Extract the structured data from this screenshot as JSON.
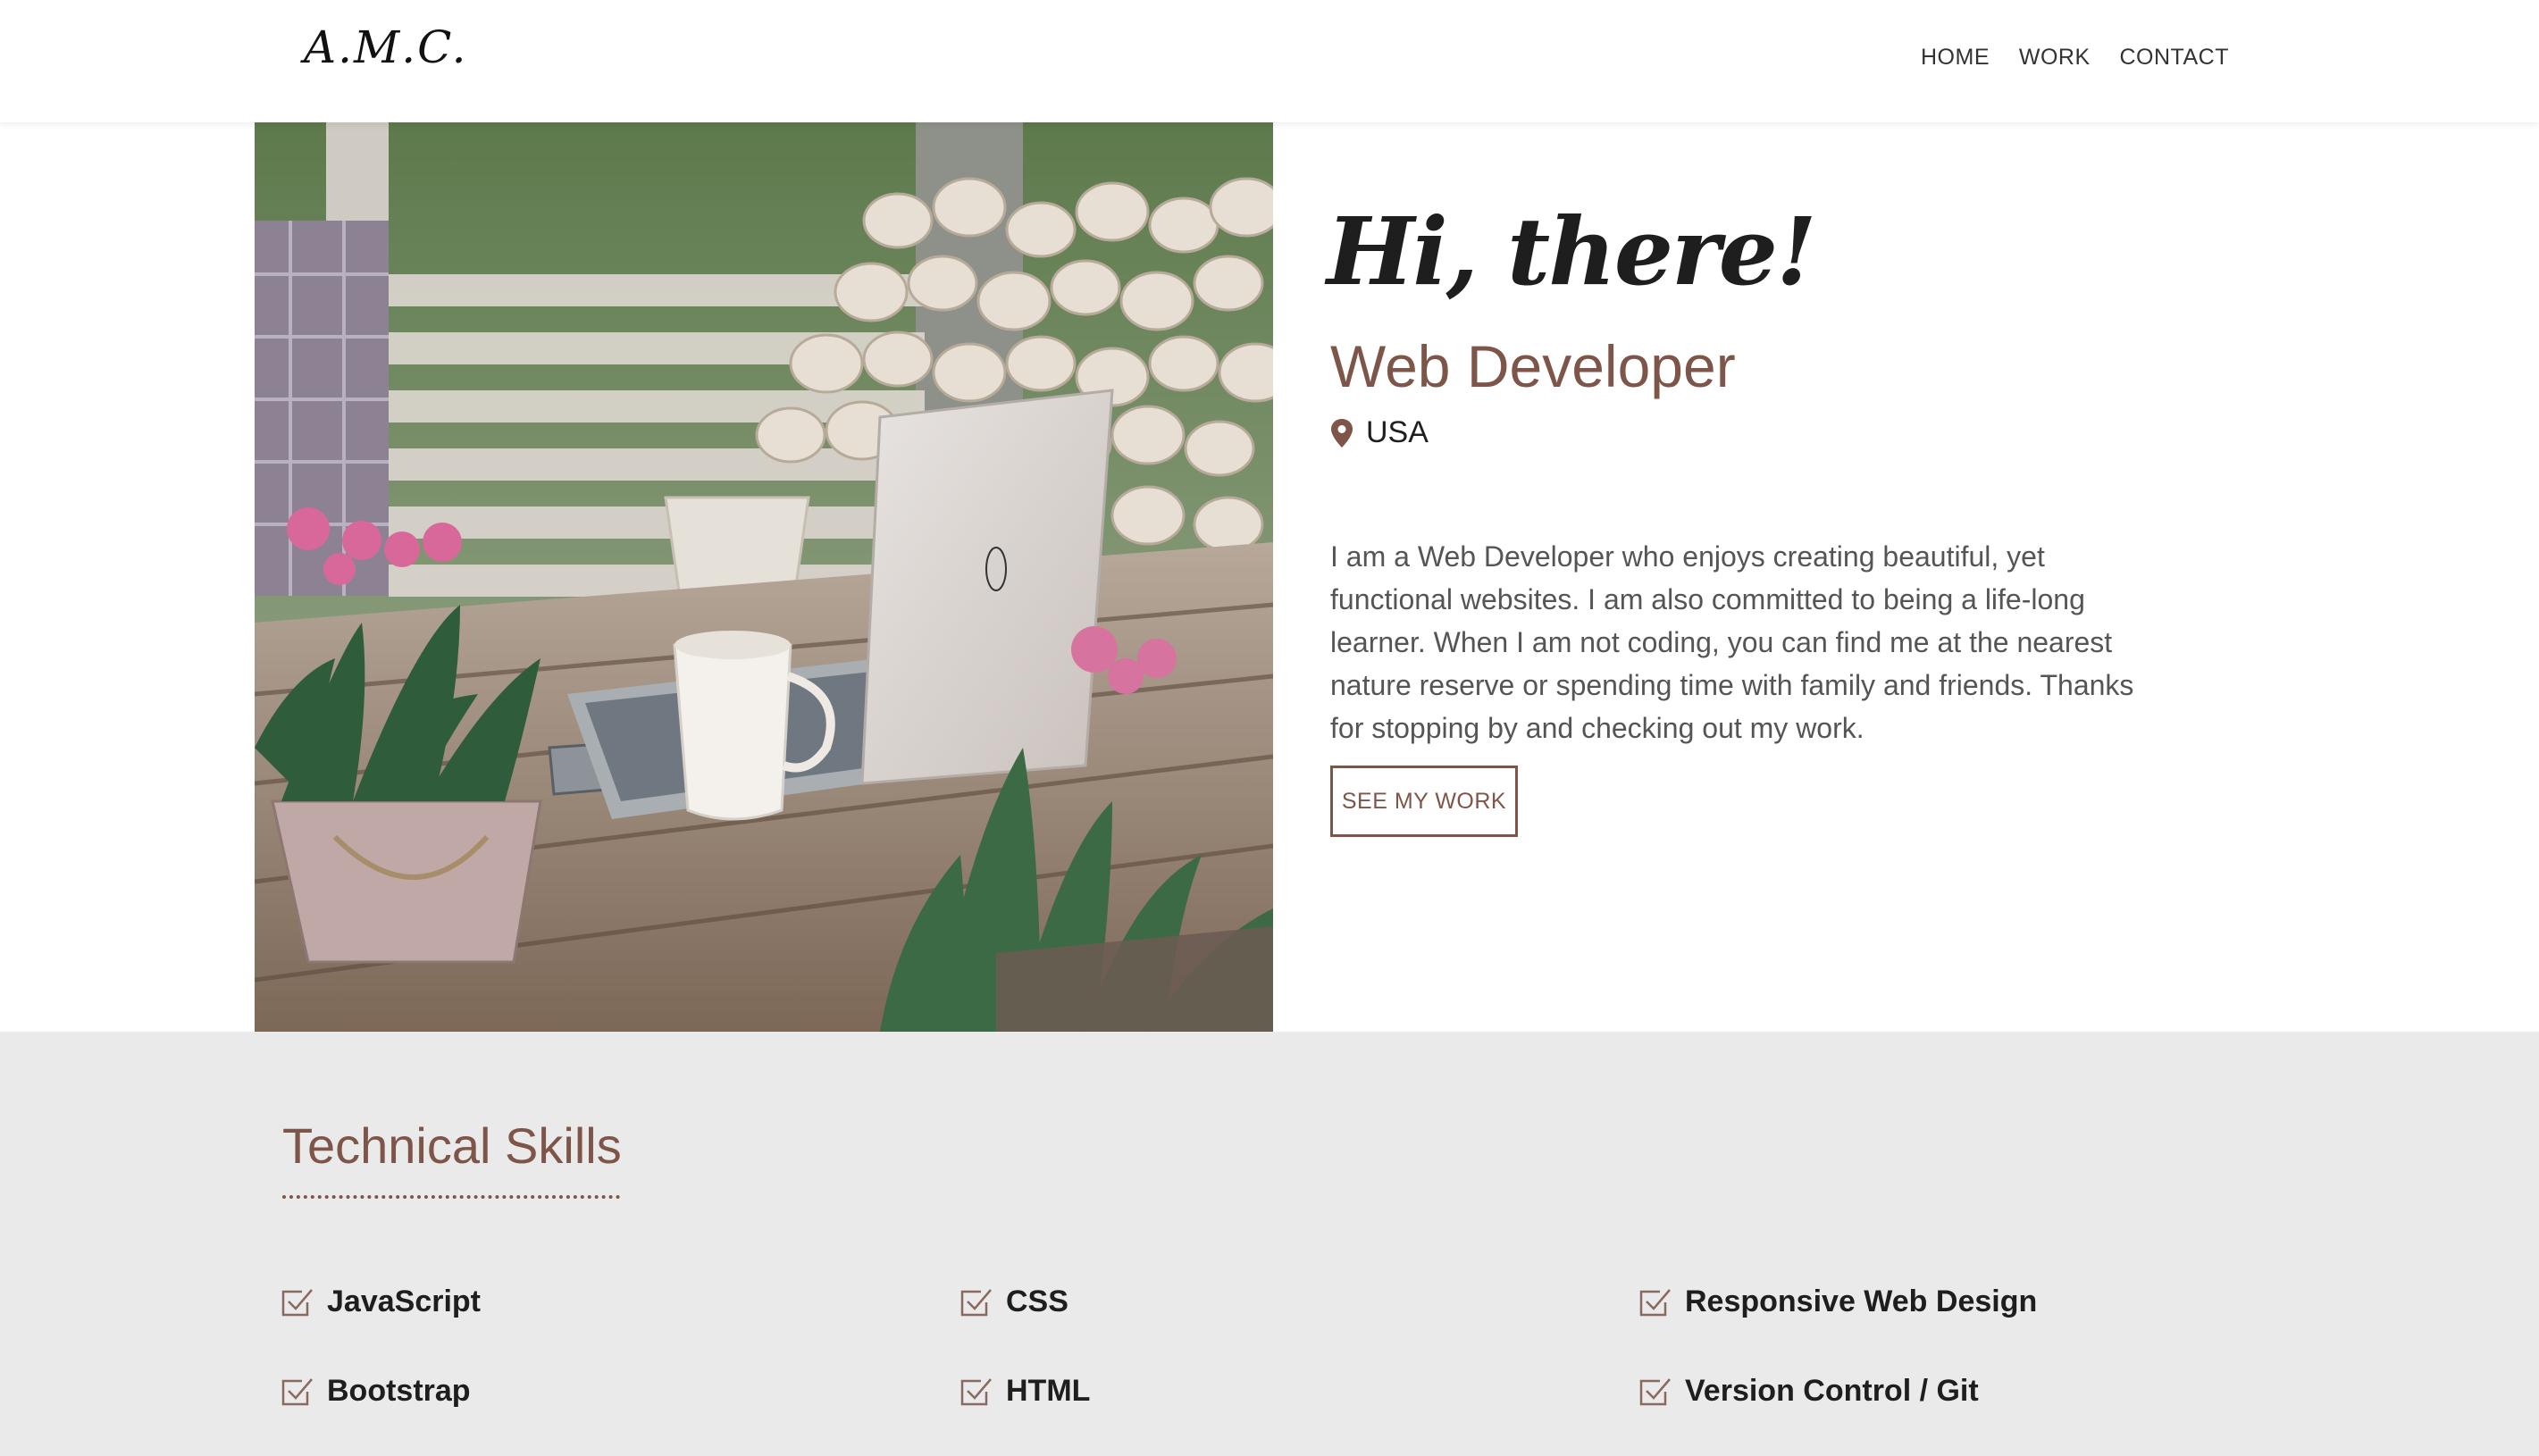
{
  "header": {
    "brand": "A.M.C.",
    "nav": [
      "HOME",
      "WORK",
      "CONTACT"
    ]
  },
  "hero": {
    "greeting": "Hi, there!",
    "role": "Web Developer",
    "location": "USA",
    "location_icon": "map-pin-icon",
    "bio": "I am a Web Developer who enjoys creating beautiful, yet functional websites. I am also committed to being a life-long learner. When I am not coding, you can find me at the nearest nature reserve or spending time with family and friends. Thanks for stopping by and checking out my work.",
    "cta_label": "SEE MY WORK"
  },
  "skills": {
    "title": "Technical Skills",
    "check_icon": "checkbox-icon",
    "items": [
      "JavaScript",
      "CSS",
      "Responsive Web Design",
      "Bootstrap",
      "HTML",
      "Version Control / Git"
    ]
  },
  "colors": {
    "accent": "#7e5549",
    "skills_background": "#ebeaea",
    "text_dark": "#1e1e1e",
    "text_muted": "#555555"
  }
}
